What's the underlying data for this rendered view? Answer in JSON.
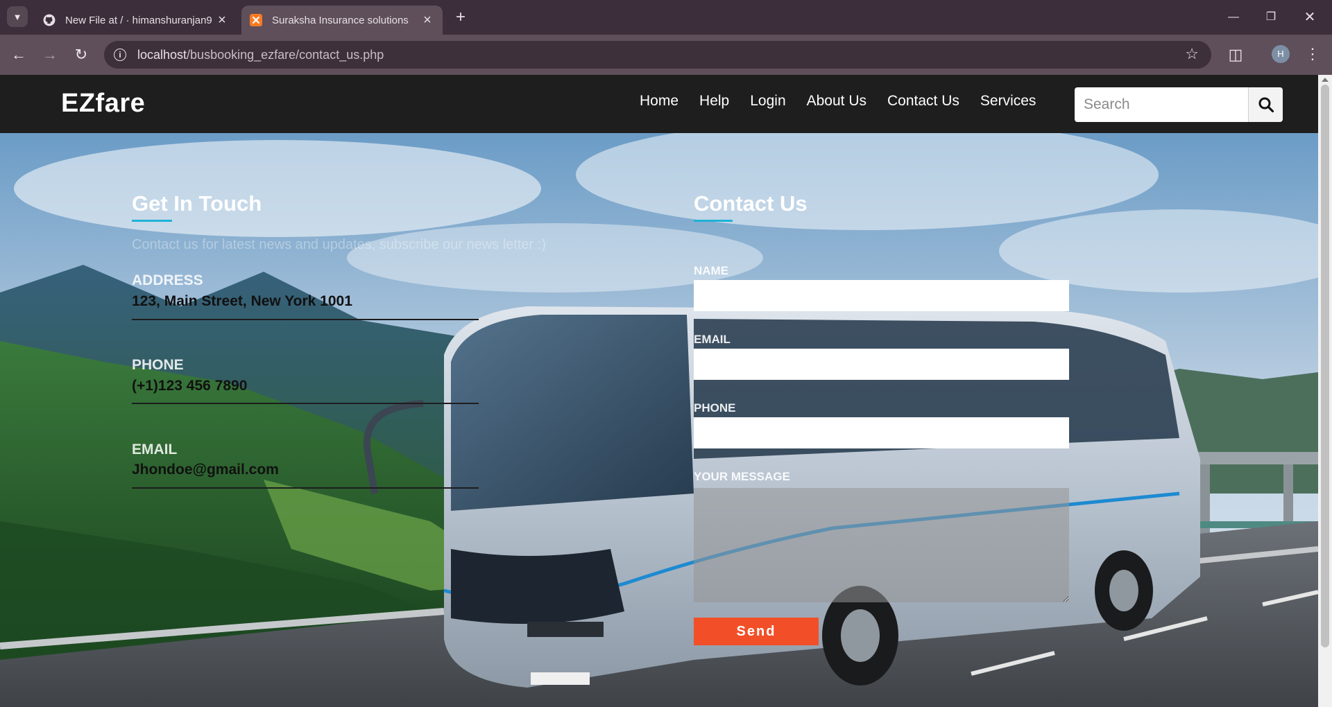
{
  "browser": {
    "tabs": [
      {
        "title": "New File at / · himanshuranjan9",
        "icon": "github-icon"
      },
      {
        "title": "Suraksha Insurance solutions",
        "icon": "xampp-icon",
        "active": true
      }
    ],
    "url_host": "localhost",
    "url_path": "/busbooking_ezfare/contact_us.php",
    "profile_initial": "H"
  },
  "site": {
    "brand": "EZfare",
    "nav": [
      "Home",
      "Help",
      "Login",
      "About Us",
      "Contact Us",
      "Services"
    ],
    "search_placeholder": "Search"
  },
  "left": {
    "title": "Get In Touch",
    "subtitle": "Contact us for latest news and updates, subscribe our news letter :)",
    "address_label": "ADDRESS",
    "address_value": "123, Main Street, New York 1001",
    "phone_label": "PHONE",
    "phone_value": "(+1)123 456 7890",
    "email_label": "EMAIL",
    "email_value": "Jhondoe@gmail.com"
  },
  "form": {
    "title": "Contact Us",
    "name_label": "NAME",
    "email_label": "EMAIL",
    "phone_label": "PHONE",
    "message_label": "YOUR MESSAGE",
    "send_label": "Send"
  },
  "colors": {
    "nav_bg": "#1f1e1e",
    "accent_underline": "#1fb2d6",
    "send_button": "#f24f28"
  }
}
